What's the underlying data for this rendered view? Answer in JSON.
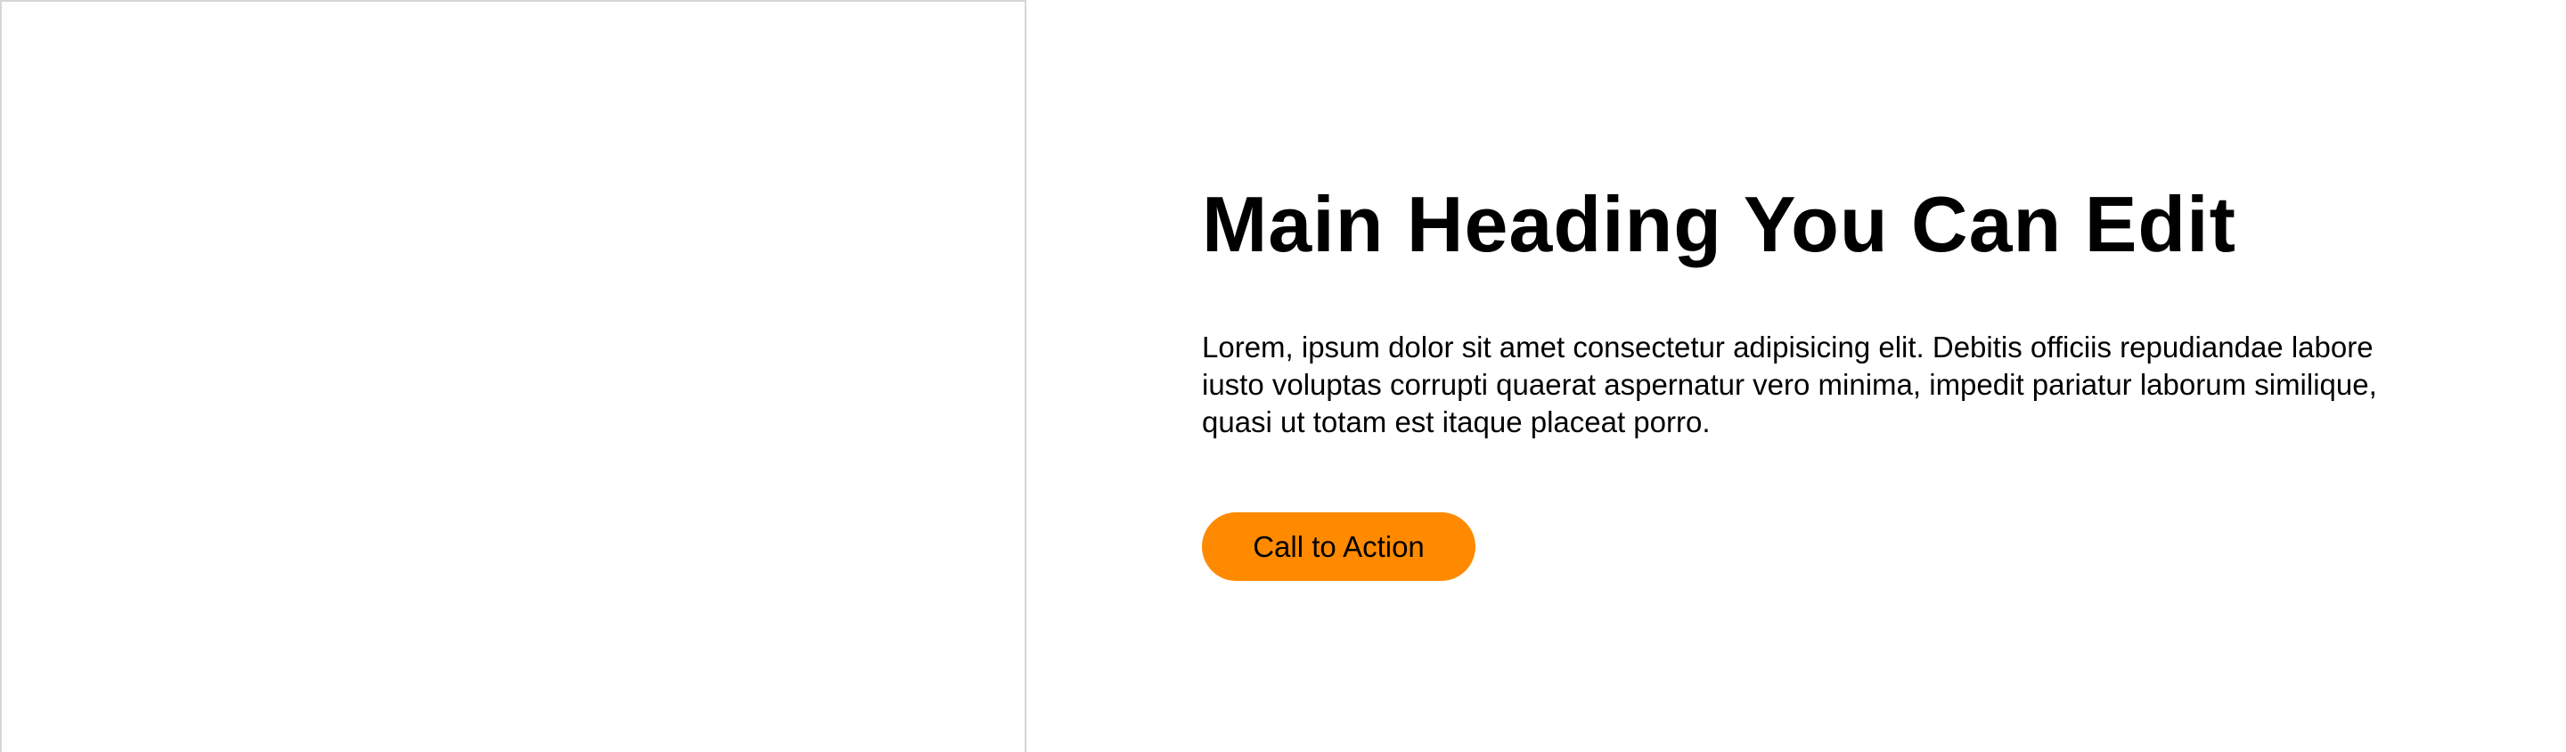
{
  "hero": {
    "heading": "Main Heading You Can Edit",
    "body": "Lorem, ipsum dolor sit amet consectetur adipisicing elit. Debitis officiis repudiandae labore iusto voluptas corrupti quaerat aspernatur vero minima, impedit pariatur laborum similique, quasi ut totam est itaque placeat porro.",
    "cta_label": "Call to Action"
  },
  "colors": {
    "accent": "#ff8a00",
    "text": "#000000",
    "panel_border": "#d6d6d6",
    "background": "#ffffff"
  }
}
